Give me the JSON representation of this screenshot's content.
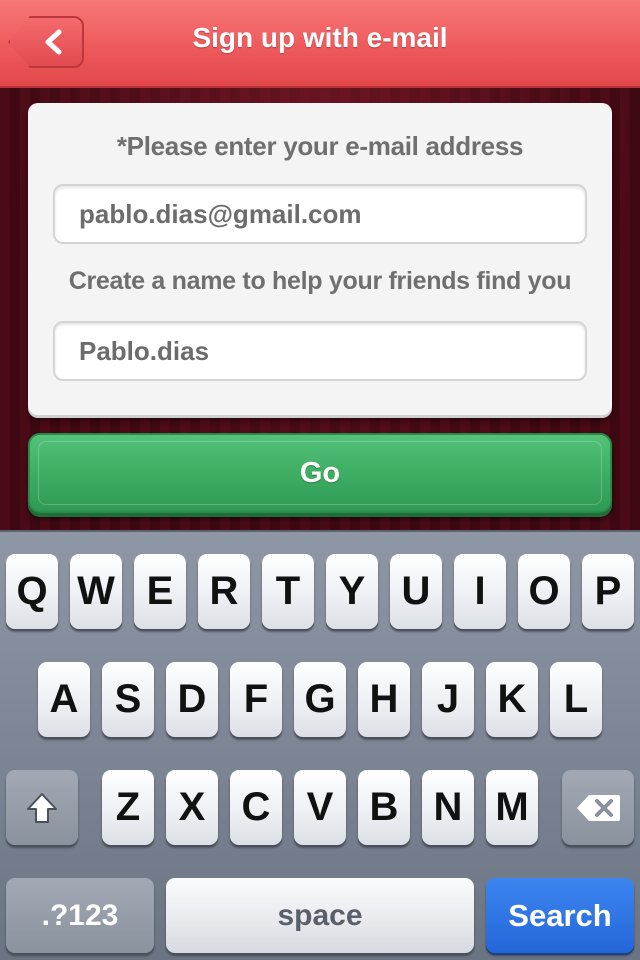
{
  "header": {
    "title": "Sign up with e-mail",
    "back_icon": "chevron-left-icon",
    "color": "#ee5a5c"
  },
  "form": {
    "email_label": "*Please enter your e-mail address",
    "email_value": "pablo.dias@gmail.com",
    "name_label": "Create a name to help your friends find you",
    "name_value": "Pablo.dias"
  },
  "go_button": {
    "label": "Go",
    "color": "#3eae63"
  },
  "keyboard": {
    "row1": [
      "Q",
      "W",
      "E",
      "R",
      "T",
      "Y",
      "U",
      "I",
      "O",
      "P"
    ],
    "row2": [
      "A",
      "S",
      "D",
      "F",
      "G",
      "H",
      "J",
      "K",
      "L"
    ],
    "row3": [
      "Z",
      "X",
      "C",
      "V",
      "B",
      "N",
      "M"
    ],
    "shift_icon": "shift-icon",
    "delete_icon": "backspace-icon",
    "numbers_label": ".?123",
    "space_label": "space",
    "search_label": "Search",
    "search_color": "#2466da"
  }
}
